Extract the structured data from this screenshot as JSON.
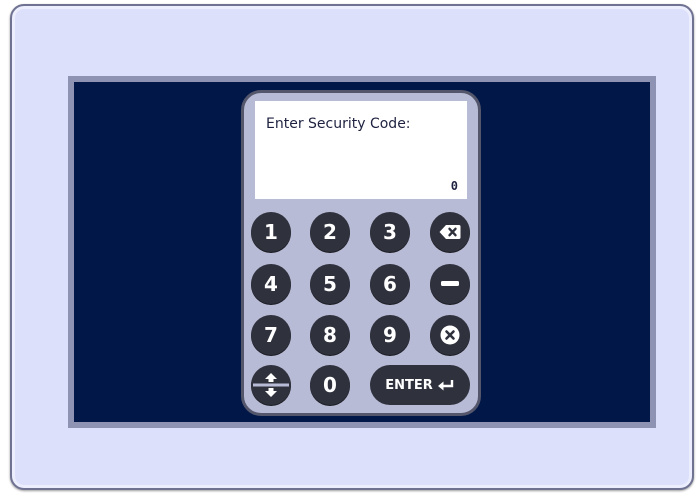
{
  "display": {
    "prompt": "Enter Security Code:",
    "value": "0"
  },
  "keys": {
    "k1": "1",
    "k2": "2",
    "k3": "3",
    "k4": "4",
    "k5": "5",
    "k6": "6",
    "k7": "7",
    "k8": "8",
    "k9": "9",
    "k0": "0",
    "enter": "ENTER"
  },
  "icons": {
    "backspace": "backspace-icon",
    "minus": "minus-icon",
    "clear": "clear-icon",
    "scroll": "up-down-arrows-icon",
    "enter_arrow": "return-arrow-icon"
  },
  "colors": {
    "device_bg": "#dde0fb",
    "screen_bg": "#011748",
    "keypad_bg": "#b8bbd5",
    "key_bg": "#2f313d"
  }
}
